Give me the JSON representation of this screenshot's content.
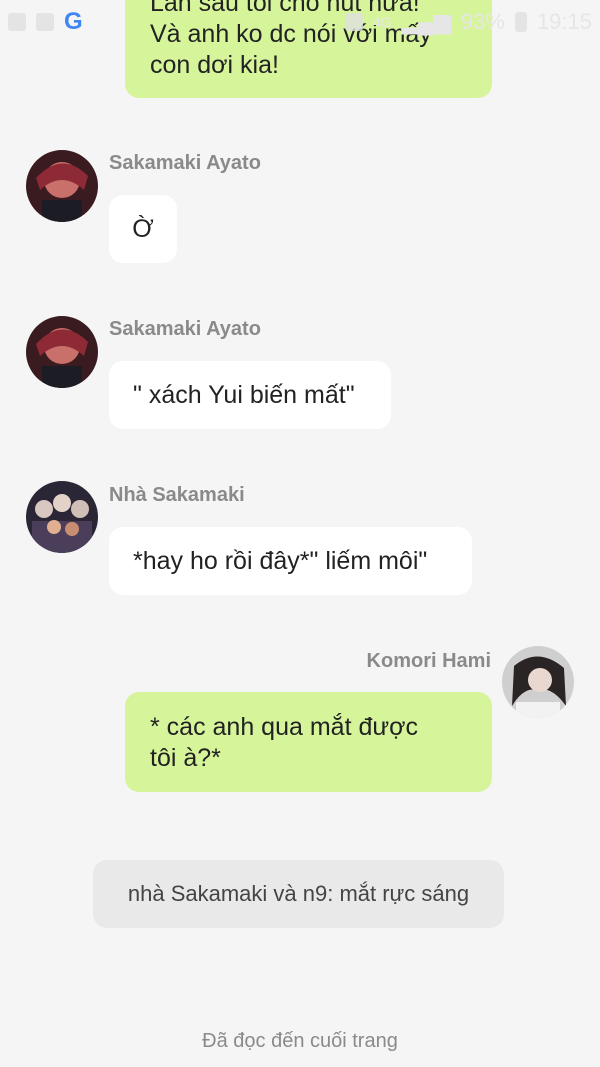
{
  "status_bar": {
    "battery": "93%",
    "time": "19:15",
    "network": "4G"
  },
  "messages": [
    {
      "direction": "out",
      "lines": [
        "Lần sau tôi cho hút nữa!",
        "Và anh ko dc nói với mấy",
        "con dơi kia!"
      ]
    },
    {
      "direction": "in",
      "sender": "Sakamaki Ayato",
      "text": "Ờ",
      "avatar": "ayato-avatar"
    },
    {
      "direction": "in",
      "sender": "Sakamaki Ayato",
      "text": "\" xách Yui biến mất\"",
      "avatar": "ayato-avatar"
    },
    {
      "direction": "in",
      "sender": "Nhà Sakamaki",
      "text": "*hay ho rồi đây*\" liếm môi\"",
      "avatar": "sakamaki-group-avatar"
    },
    {
      "direction": "out",
      "sender": "Komori Hami",
      "lines": [
        "* các anh qua mắt được",
        "tôi à?*"
      ],
      "avatar": "hami-avatar"
    }
  ],
  "system_message": "nhà Sakamaki và n9: mắt rực sáng",
  "footer": "Đã đọc đến cuối trang",
  "colors": {
    "background": "#f5f5f5",
    "outgoing_bubble": "#d6f59a",
    "incoming_bubble": "#ffffff",
    "system_bubble": "#e9e9e9"
  }
}
